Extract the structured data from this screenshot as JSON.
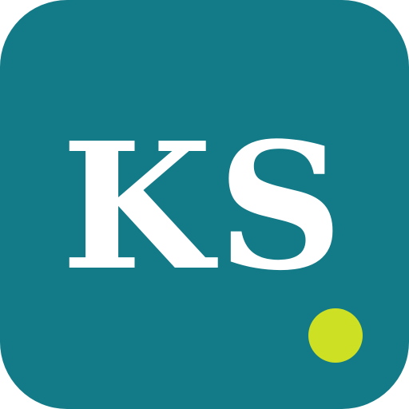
{
  "app_icon": {
    "monogram": "KS",
    "background_color": "#137a87",
    "text_color": "#ffffff",
    "indicator_dot_color": "#cde024"
  }
}
